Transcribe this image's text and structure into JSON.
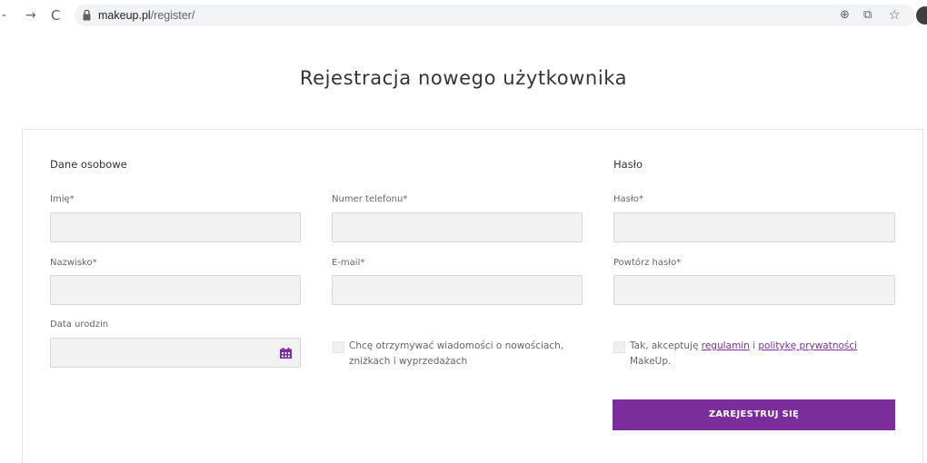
{
  "browser": {
    "back_icon": "-",
    "forward_icon": "→",
    "reload_icon": "C",
    "url_domain": "makeup.pl",
    "url_path": "/register/",
    "zoom_icon": "⊕",
    "translate_icon": "⧉",
    "star_icon": "☆"
  },
  "page": {
    "title": "Rejestracja nowego użytkownika"
  },
  "personal": {
    "heading": "Dane osobowe",
    "first_name_label": "Imię*",
    "last_name_label": "Nazwisko*",
    "birthdate_label": "Data urodzin"
  },
  "contact": {
    "phone_label": "Numer telefonu*",
    "email_label": "E-mail*",
    "newsletter_text_line1": "Chcę otrzymywać wiadomości o nowościach,",
    "newsletter_text_line2": "zniżkach i wyprzedażach"
  },
  "password": {
    "heading": "Hasło",
    "password_label": "Hasło*",
    "repeat_label": "Powtórz hasło*",
    "terms_prefix": "Tak, akceptuję ",
    "terms_link": "regulamin",
    "terms_and": " i ",
    "privacy_link": "politykę prywatności",
    "terms_suffix": "MakeUp."
  },
  "submit_label": "ZAREJESTRUJ SIĘ",
  "colors": {
    "accent": "#7b2d9c",
    "input_bg": "#f2f2f3",
    "input_border": "#d6d6d8"
  }
}
